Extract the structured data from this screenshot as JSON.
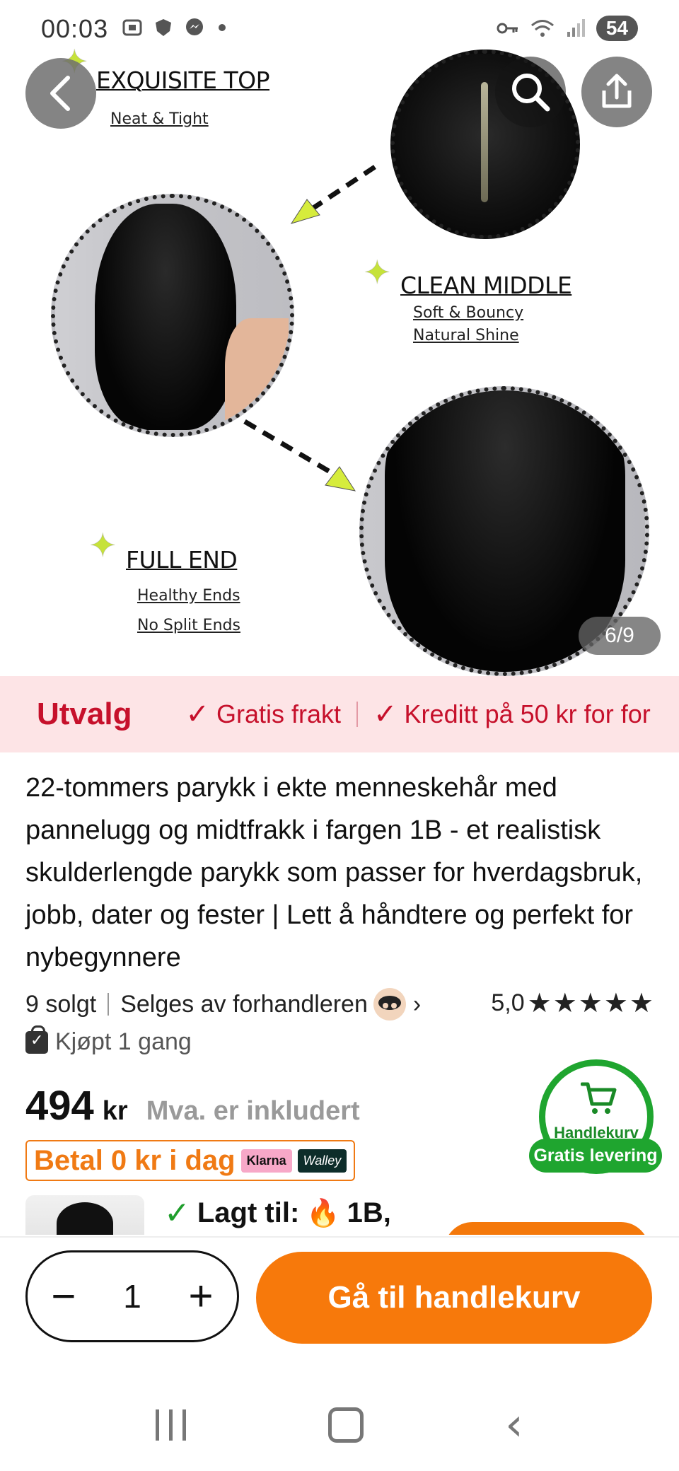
{
  "status_bar": {
    "time": "00:03",
    "battery": "54"
  },
  "gallery": {
    "page_indicator": "6/9",
    "captions": {
      "top_title": "EXQUISITE TOP",
      "top_sub": "Neat & Tight",
      "middle_title": "CLEAN MIDDLE",
      "middle_sub1": "Soft & Bouncy",
      "middle_sub2": "Natural Shine",
      "end_title": "FULL END",
      "end_sub1": "Healthy Ends",
      "end_sub2": "No Split Ends"
    }
  },
  "banner": {
    "brand": "Utvalg",
    "items": [
      "Gratis frakt",
      "Kreditt på 50 kr for for"
    ]
  },
  "product": {
    "title": "22-tommers parykk i ekte menneskehår med pannelugg og midtfrakk i fargen 1B - et realistisk skulderlengde parykk som passer for hverdagsbruk, jobb, dater og fester | Lett å håndtere og perfekt for nybegynnere",
    "sold": "9 solgt",
    "seller": "Selges av forhandleren",
    "rating": "5,0",
    "stars": "★★★★★",
    "bought": "Kjøpt 1 gang",
    "price": "494",
    "currency": "kr",
    "vat_note": "Mva. er inkludert",
    "pay_later": "Betal 0 kr i dag",
    "klarna": "Klarna",
    "walley": "Walley"
  },
  "cart_badge": {
    "label": "Handlekurv",
    "free_delivery": "Gratis levering"
  },
  "added": {
    "label": "Lagt til:",
    "variant": "1B,"
  },
  "action_bar": {
    "quantity": "1",
    "cta": "Gå til handlekurv"
  },
  "colors": {
    "accent_orange": "#f7790b",
    "banner_red": "#c6102b",
    "banner_bg": "#fde4e6",
    "green": "#1fa52f"
  }
}
